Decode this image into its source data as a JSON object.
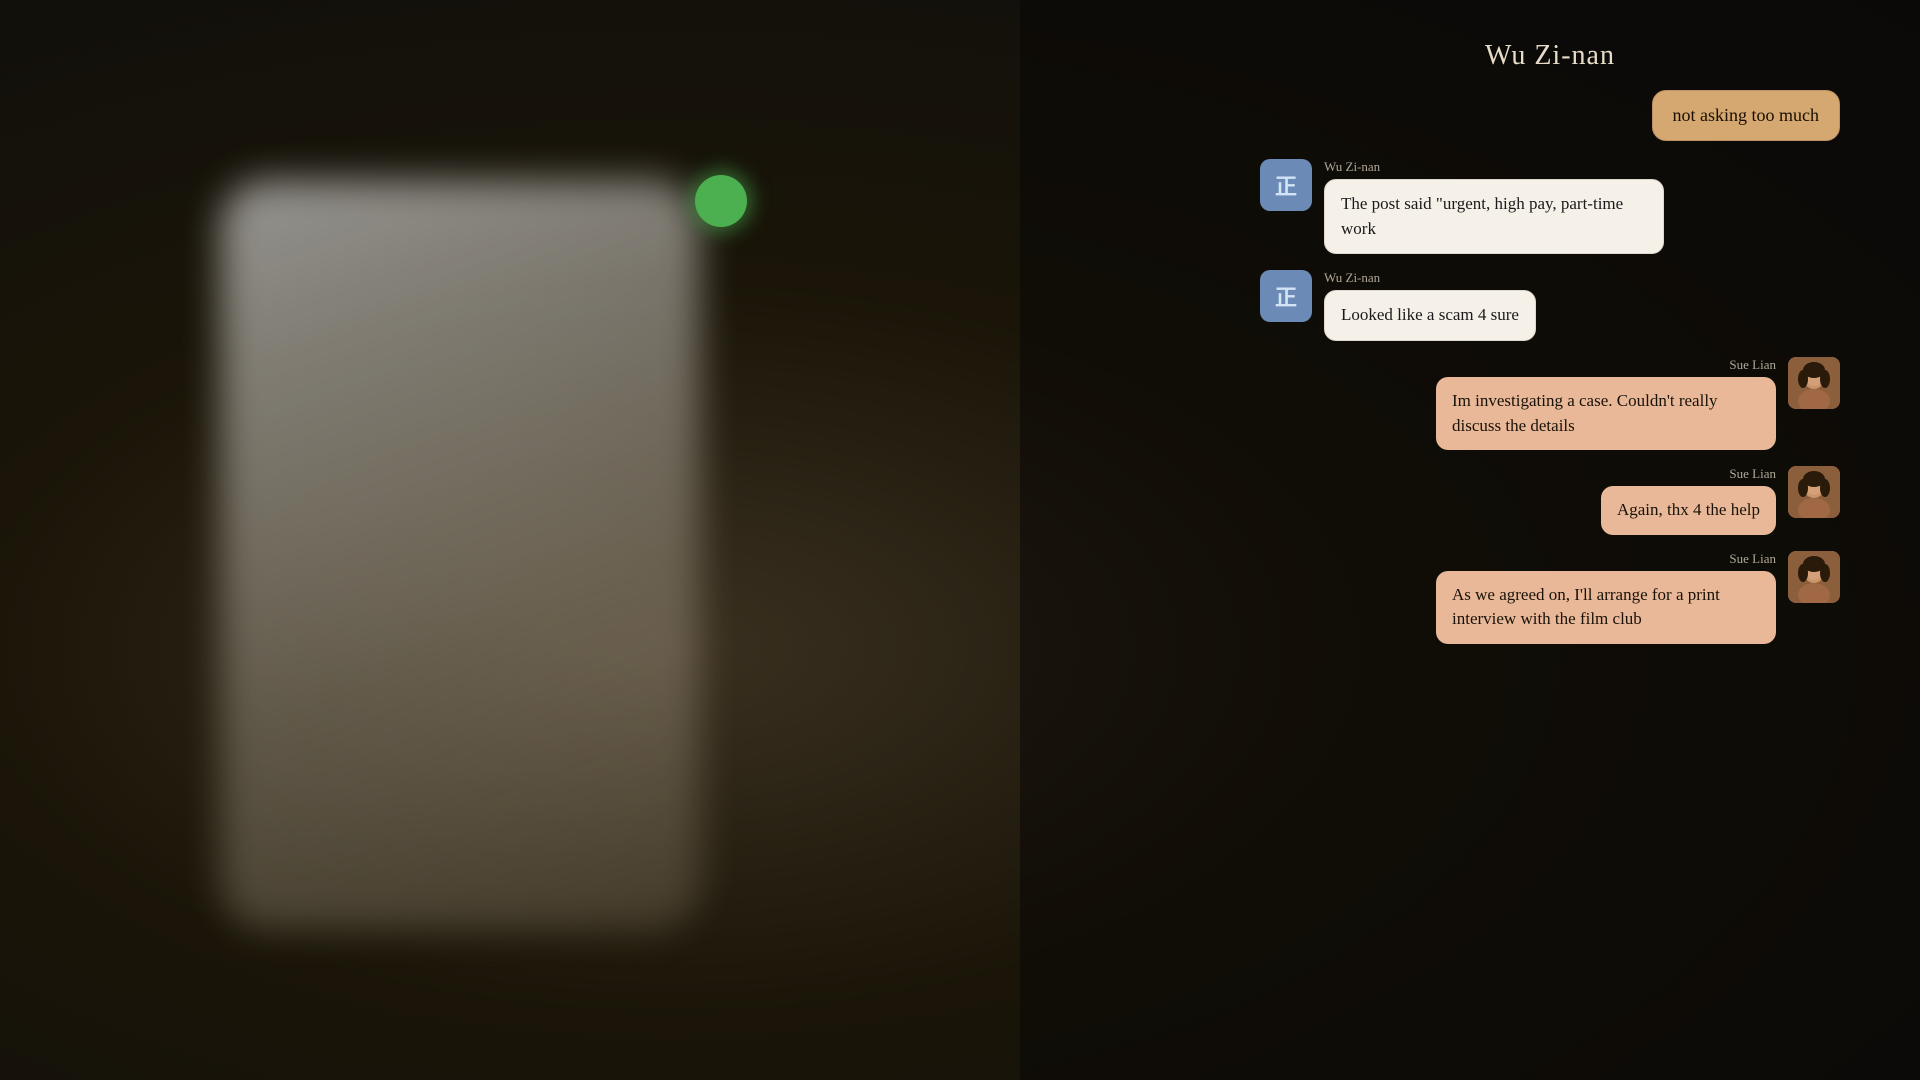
{
  "background": {
    "color": "#1a1508"
  },
  "chat": {
    "contact_name": "Wu Zi-nan",
    "messages": [
      {
        "id": "msg1",
        "sender": "me",
        "sender_name": null,
        "text": "not asking too much",
        "avatar": null
      },
      {
        "id": "msg2",
        "sender": "wu",
        "sender_name": "Wu Zi-nan",
        "text": "The post said \"urgent, high pay, part-time work",
        "avatar": "wu-icon"
      },
      {
        "id": "msg3",
        "sender": "wu",
        "sender_name": "Wu Zi-nan",
        "text": "Looked like a scam 4 sure",
        "avatar": "wu-icon"
      },
      {
        "id": "msg4",
        "sender": "me",
        "sender_name": "Sue Lian",
        "text": "Im investigating a case. Couldn't really discuss the details",
        "avatar": "sue-photo"
      },
      {
        "id": "msg5",
        "sender": "me",
        "sender_name": "Sue Lian",
        "text": "Again, thx 4 the help",
        "avatar": "sue-photo"
      },
      {
        "id": "msg6",
        "sender": "me",
        "sender_name": "Sue Lian",
        "text": "As we agreed on, I'll arrange for a print interview with the film club",
        "avatar": "sue-photo"
      }
    ],
    "wu_avatar_char": "正",
    "sue_name": "Sue Lian",
    "wu_name": "Wu Zi-nan"
  }
}
